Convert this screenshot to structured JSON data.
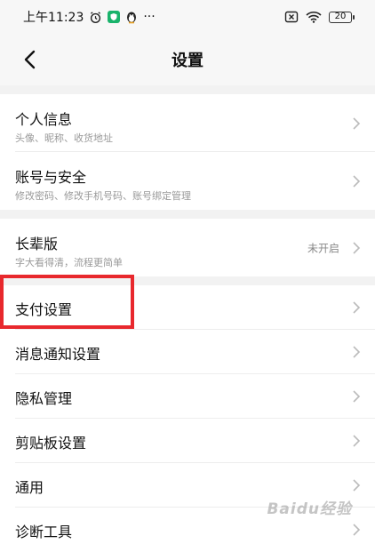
{
  "status": {
    "time": "上午11:23",
    "dots": "···",
    "battery": "20"
  },
  "nav": {
    "title": "设置"
  },
  "groups": [
    [
      {
        "title": "个人信息",
        "subtitle": "头像、昵称、收货地址"
      },
      {
        "title": "账号与安全",
        "subtitle": "修改密码、修改手机号码、账号绑定管理"
      }
    ],
    [
      {
        "title": "长辈版",
        "subtitle": "字大看得清，流程更简单",
        "value": "未开启"
      }
    ],
    [
      {
        "title": "支付设置"
      },
      {
        "title": "消息通知设置"
      },
      {
        "title": "隐私管理"
      },
      {
        "title": "剪贴板设置"
      },
      {
        "title": "通用"
      },
      {
        "title": "诊断工具"
      }
    ]
  ],
  "watermark": "Baidu经验",
  "colors": {
    "highlight": "#e8282d",
    "shield": "#19b36b"
  }
}
